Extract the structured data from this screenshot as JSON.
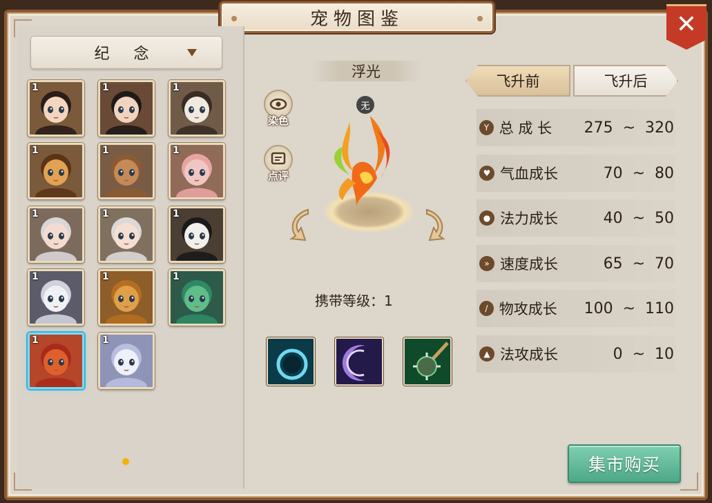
{
  "window": {
    "title": "宠物图鉴"
  },
  "filter": {
    "label": "纪 念"
  },
  "pets": [
    {
      "level": "1",
      "kind": "girl-dark-hair",
      "bg": "#7b5a3c",
      "face": "#f3d5c0",
      "hair": "#2a1d18"
    },
    {
      "level": "1",
      "kind": "boy-dark-hair",
      "bg": "#6a4a36",
      "face": "#f1d4bf",
      "hair": "#1f1a18"
    },
    {
      "level": "1",
      "kind": "siamese-cat",
      "bg": "#6f5b48",
      "face": "#efe9e0",
      "hair": "#3a2c24"
    },
    {
      "level": "1",
      "kind": "tiger-cat",
      "bg": "#7b5a3c",
      "face": "#e2a253",
      "hair": "#5a3417"
    },
    {
      "level": "1",
      "kind": "deer",
      "bg": "#7a5c44",
      "face": "#c48a57",
      "hair": "#8a5b34"
    },
    {
      "level": "1",
      "kind": "pink-rabbit",
      "bg": "#8f6b58",
      "face": "#f0c6c2",
      "hair": "#e8a4a3"
    },
    {
      "level": "1",
      "kind": "silver-hair-boy",
      "bg": "#7c6a5c",
      "face": "#f3dccf",
      "hair": "#d9d6d6"
    },
    {
      "level": "1",
      "kind": "silver-hair-girl",
      "bg": "#80705f",
      "face": "#f5dfd2",
      "hair": "#dcd8d8"
    },
    {
      "level": "1",
      "kind": "panda",
      "bg": "#4b3f34",
      "face": "#f2f0ec",
      "hair": "#1a1a1a"
    },
    {
      "level": "1",
      "kind": "white-bear",
      "bg": "#5c5b6a",
      "face": "#f0f1f5",
      "hair": "#cfd2dc"
    },
    {
      "level": "1",
      "kind": "golden-lion",
      "bg": "#8d5d2a",
      "face": "#e0a049",
      "hair": "#b56e21"
    },
    {
      "level": "1",
      "kind": "green-dragon",
      "bg": "#2e5a4a",
      "face": "#5fbd8a",
      "hair": "#2e8a64"
    },
    {
      "level": "1",
      "kind": "red-phoenix",
      "bg": "#b4462a",
      "face": "#e0602d",
      "hair": "#a92a1a"
    },
    {
      "level": "1",
      "kind": "white-rabbit",
      "bg": "#8e94b5",
      "face": "#eef0fb",
      "hair": "#b9bde0"
    }
  ],
  "pet": {
    "name": "浮光",
    "element_tag": "无",
    "carry_level": "携带等级：1",
    "side_buttons": [
      {
        "label": "染色",
        "icon": "eye-icon"
      },
      {
        "label": "点评",
        "icon": "comment-icon"
      }
    ],
    "skills": [
      {
        "icon": "ring-skill-icon",
        "bg": "#0b3a48",
        "accent": "#6fd8ee"
      },
      {
        "icon": "crescent-skill-icon",
        "bg": "#231a4a",
        "accent": "#a07ae0"
      },
      {
        "icon": "mace-skill-icon",
        "bg": "#0f4a2a",
        "accent": "#7ad090"
      }
    ]
  },
  "tabs": [
    {
      "label": "飞升前",
      "active": true
    },
    {
      "label": "飞升后",
      "active": false
    }
  ],
  "stats": [
    {
      "icon": "growth-icon",
      "name": "总 成 长",
      "value": "275  ~  320"
    },
    {
      "icon": "heart-icon",
      "name": "气血成长",
      "value": "70  ~  80"
    },
    {
      "icon": "drop-icon",
      "name": "法力成长",
      "value": "40  ~  50"
    },
    {
      "icon": "speed-icon",
      "name": "速度成长",
      "value": "65  ~  70"
    },
    {
      "icon": "sword-icon",
      "name": "物攻成长",
      "value": "100  ~  110"
    },
    {
      "icon": "flame-icon",
      "name": "法攻成长",
      "value": "0  ~  10"
    }
  ],
  "market_button": {
    "label": "集市购买"
  },
  "colors": {
    "accent_green": "#5fb898",
    "close_red": "#c43a26",
    "frame_brown": "#8a5a36"
  }
}
